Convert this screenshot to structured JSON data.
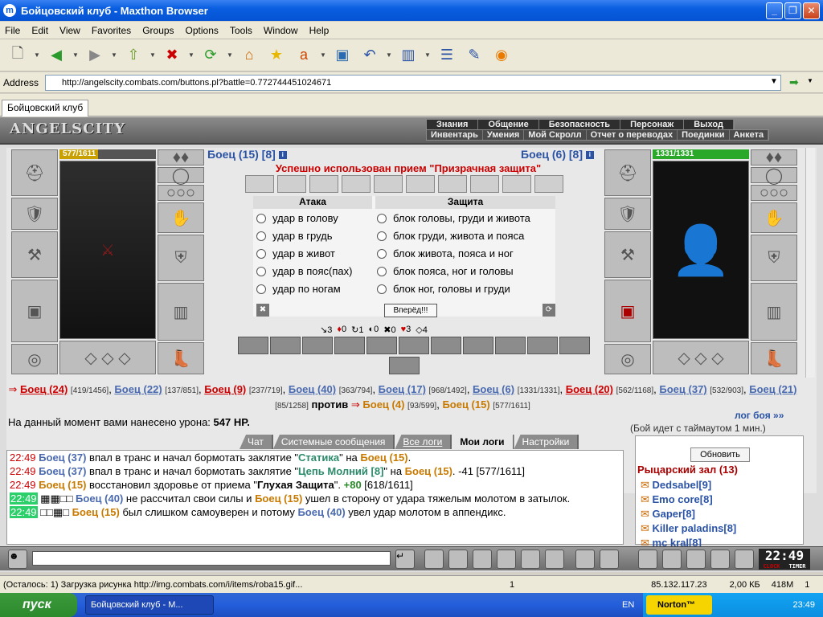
{
  "window": {
    "title": "Бойцовский клуб - Maxthon Browser"
  },
  "menu": [
    "File",
    "Edit",
    "View",
    "Favorites",
    "Groups",
    "Options",
    "Tools",
    "Window",
    "Help"
  ],
  "address": {
    "label": "Address",
    "url": "http://angelscity.combats.com/buttons.pl?battle=0.772744451024671"
  },
  "tab": {
    "label": "Бойцовский клуб"
  },
  "game": {
    "logo": "ANGELSCITY",
    "nav_top": [
      "Знания",
      "Общение",
      "Безопасность",
      "Персонаж",
      "Выход"
    ],
    "nav_bottom": [
      "Инвентарь",
      "Умения",
      "Мой Скролл",
      "Отчет о переводах",
      "Поединки",
      "Анкета"
    ],
    "left_fighter": {
      "name": "Боец (15) [8]",
      "hp": "577/1611"
    },
    "right_fighter": {
      "name": "Боец (6) [8]",
      "hp": "1331/1331"
    },
    "message": "Успешно использован прием \"Призрачная защита\"",
    "attack_header": "Атака",
    "defense_header": "Защита",
    "attacks": [
      "удар в голову",
      "удар в грудь",
      "удар в живот",
      "удар в пояс(пах)",
      "удар по ногам"
    ],
    "defenses": [
      "блок головы, груди и живота",
      "блок груди, живота и пояса",
      "блок живота, пояса и ног",
      "блок пояса, ног и головы",
      "блок ног, головы и груди"
    ],
    "go_button": "Вперёд!!!",
    "stats": [
      "3",
      "0",
      "1",
      "0",
      "0",
      "3",
      "4"
    ],
    "teams": {
      "team1": [
        {
          "n": "Боец (24)",
          "v": "[419/1456]",
          "c": "red"
        },
        {
          "n": "Боец (22)",
          "v": "[137/851]",
          "c": "blue"
        },
        {
          "n": "Боец (9)",
          "v": "[237/719]",
          "c": "red"
        },
        {
          "n": "Боец (40)",
          "v": "[363/794]",
          "c": "blue"
        },
        {
          "n": "Боец (17)",
          "v": "[968/1492]",
          "c": "blue"
        },
        {
          "n": "Боец (6)",
          "v": "[1331/1331]",
          "c": "blue"
        },
        {
          "n": "Боец (20)",
          "v": "[562/1168]",
          "c": "red"
        },
        {
          "n": "Боец (37)",
          "v": "[532/903]",
          "c": "blue"
        },
        {
          "n": "Боец (21)",
          "v": "[85/1258]",
          "c": "blue"
        }
      ],
      "versus": "против",
      "team2": [
        {
          "n": "Боец (4)",
          "v": "[93/599]",
          "c": "orange"
        },
        {
          "n": "Боец (15)",
          "v": "[577/1611]",
          "c": "orange"
        }
      ]
    },
    "damage_label": "На данный момент вами нанесено урона:",
    "damage_value": "547 HP.",
    "log_link": "лог боя »»",
    "timeout_text": "(Бой идет с таймаутом 1 мин.)",
    "log_tabs": [
      "Чат",
      "Системные сообщения",
      "Все логи",
      "Мои логи",
      "Настройки"
    ],
    "refresh_button": "Обновить",
    "room_title": "Рыцарский зал (13)",
    "players": [
      "Dedsabel[9]",
      "Emo core[8]",
      "Gaper[8]",
      "Killer paladins[8]",
      "mc kral[8]"
    ],
    "clock": "22:49",
    "clock_labels": [
      "CLOCK",
      "TIMER"
    ]
  },
  "log": [
    {
      "t": "22:49",
      "a": "Боец (37)",
      "txt1": " впал в транс и начал бормотать заклятие \"",
      "spell": "Статика",
      "txt2": "\" на ",
      "b": "Боец (15)",
      "tail": "."
    },
    {
      "t": "22:49",
      "a": "Боец (37)",
      "txt1": " впал в транс и начал бормотать заклятие \"",
      "spell": "Цепь Молний [8]",
      "txt2": "\" на ",
      "b": "Боец (15)",
      "tail": ". -41 [577/1611]"
    },
    {
      "t": "22:49",
      "a": "Боец (15)",
      "txt1": " восстановил здоровье от приема \"",
      "spell": "Глухая Защита",
      "txt2": "\". ",
      "b": "+80",
      "tail": " [618/1611]"
    },
    {
      "t": "22:49",
      "a": "Боец (40)",
      "txt1": " не рассчитал свои силы и ",
      "spell": "",
      "txt2": "",
      "b": "Боец (15)",
      "tail": " ушел в сторону от удара тяжелым молотом в затылок."
    },
    {
      "t": "22:49",
      "a": "Боец (15)",
      "txt1": " был слишком самоуверен и потому ",
      "spell": "",
      "txt2": "",
      "b": "Боец (40)",
      "tail": " увел удар молотом в аппендикс."
    }
  ],
  "status": {
    "text": "(Осталось: 1) Загрузка рисунка http://img.combats.com/i/items/roba15.gif...",
    "count": "1",
    "ip": "85.132.117.23",
    "size": "2,00 КБ",
    "mem": "418M",
    "num": "1"
  },
  "taskbar": {
    "start": "пуск",
    "task": "Бойцовский клуб - M...",
    "lang": "EN",
    "norton": "Norton™",
    "time": "23:49"
  }
}
